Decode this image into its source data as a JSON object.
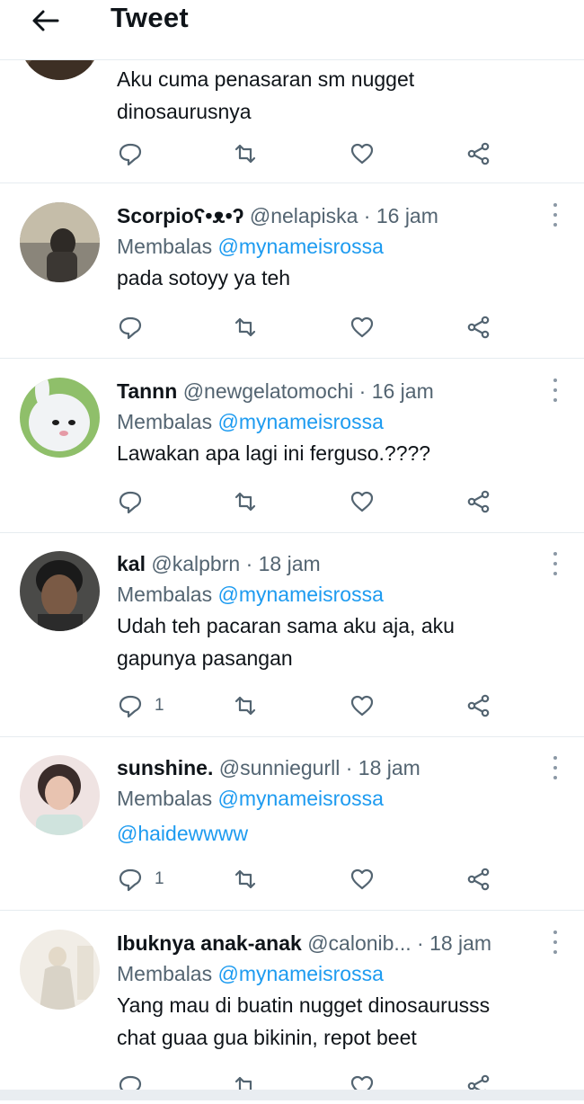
{
  "header": {
    "title": "Tweet"
  },
  "reply_prefix": "Membalas",
  "tweets": [
    {
      "name": "",
      "handle": "",
      "time": "",
      "reply_to": "",
      "text_lines": [
        "Aku cuma penasaran sm nugget",
        "dinosaurusnya"
      ],
      "reply_count": "",
      "avatar_colors": [
        "#5b4a3b",
        "#a98a6a"
      ]
    },
    {
      "name": "Scorpioʕ•ᴥ•ʔ",
      "handle": "@nelapiska",
      "time": "16 jam",
      "reply_to": "@mynameisrossa",
      "text_lines": [
        "pada sotoyy ya teh"
      ],
      "reply_count": "",
      "avatar_colors": [
        "#6d6a60",
        "#c5bda9"
      ]
    },
    {
      "name": "Tannn",
      "handle": "@newgelatomochi",
      "time": "16 jam",
      "reply_to": "@mynameisrossa",
      "text_lines": [
        "Lawakan apa lagi ini ferguso.????"
      ],
      "reply_count": "",
      "avatar_colors": [
        "#e9ecef",
        "#8fbf6a"
      ]
    },
    {
      "name": "kal",
      "handle": "@kalpbrn",
      "time": "18 jam",
      "reply_to": "@mynameisrossa",
      "text_lines": [
        "Udah teh pacaran sama aku aja, aku",
        "gapunya pasangan"
      ],
      "reply_count": "1",
      "avatar_colors": [
        "#3a3a3a",
        "#7a5a45"
      ]
    },
    {
      "name": "sunshine.",
      "handle": "@sunniegurll",
      "time": "18 jam",
      "reply_to": "@mynameisrossa",
      "text_lines": [
        "@haidewwww"
      ],
      "reply_count": "1",
      "avatar_colors": [
        "#f2e6e4",
        "#d8b6a6"
      ]
    },
    {
      "name": "Ibuknya anak-anak",
      "handle": "@calonib...",
      "time": "18 jam",
      "reply_to": "@mynameisrossa",
      "text_lines": [
        "Yang mau di buatin nugget dinosaurusss",
        "chat guaa gua bikinin, repot beet"
      ],
      "reply_count": "",
      "avatar_colors": [
        "#f1ede6",
        "#cfc7b8"
      ]
    }
  ],
  "colors": {
    "accent": "#1d9bf0",
    "muted": "#536471",
    "divider": "#e6ecf0"
  },
  "icons": [
    "back-arrow-icon",
    "reply-icon",
    "retweet-icon",
    "like-icon",
    "share-icon",
    "more-vertical-icon"
  ]
}
